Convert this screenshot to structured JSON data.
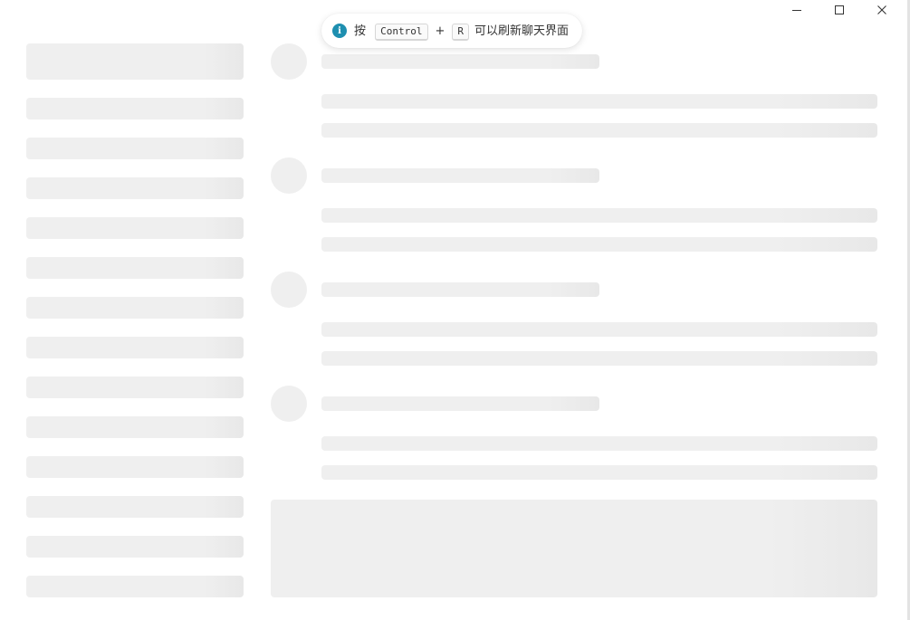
{
  "toast": {
    "icon": "info-icon",
    "icon_glyph": "i",
    "prefix": "按",
    "key1": "Control",
    "plus": "+",
    "key2": "R",
    "suffix": "可以刷新聊天界面"
  },
  "window_controls": {
    "minimize": "minimize-icon",
    "maximize": "maximize-icon",
    "close": "close-icon"
  },
  "colors": {
    "skeleton": "#efefef",
    "info_accent": "#1e8fb0",
    "background": "#ffffff"
  }
}
